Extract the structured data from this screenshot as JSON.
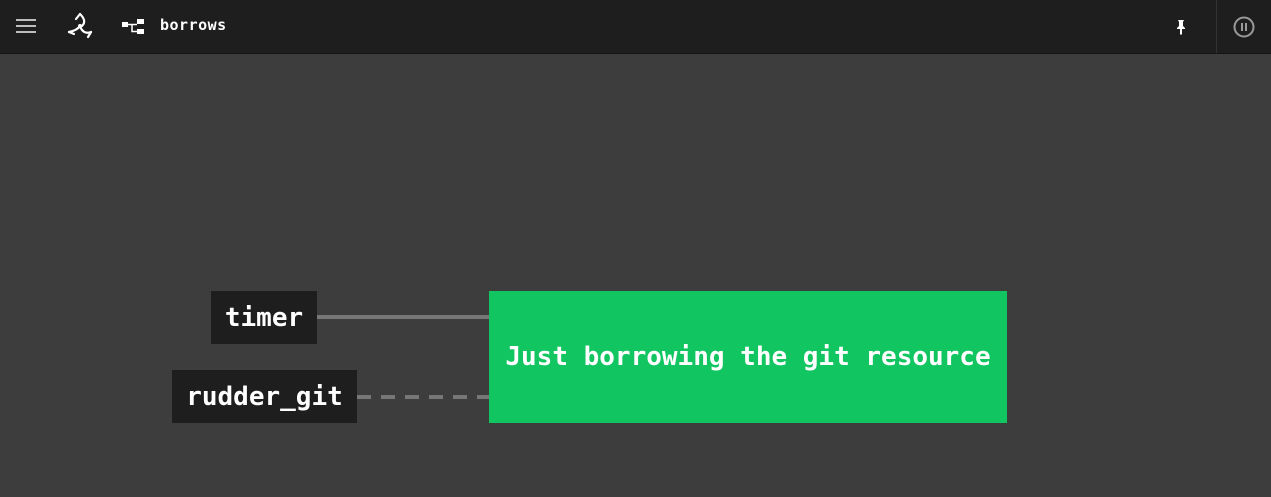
{
  "header": {
    "menu_icon": "hamburger-icon",
    "logo_icon": "concourse-logo-icon",
    "pipeline_icon": "pipeline-icon",
    "pipeline_name": "borrows",
    "pin_icon": "pin-icon",
    "pause_icon": "pause-circle-icon"
  },
  "graph": {
    "inputs": [
      {
        "name": "timer",
        "trigger": true
      },
      {
        "name": "rudder_git",
        "trigger": false
      }
    ],
    "job": {
      "name": "Just borrowing the git resource",
      "status": "succeeded",
      "color": "#11c560"
    }
  },
  "colors": {
    "background": "#3d3d3d",
    "topbar": "#1e1e1e",
    "resource_box": "#1e1e1e",
    "job_success": "#11c560",
    "edge": "#777777"
  }
}
